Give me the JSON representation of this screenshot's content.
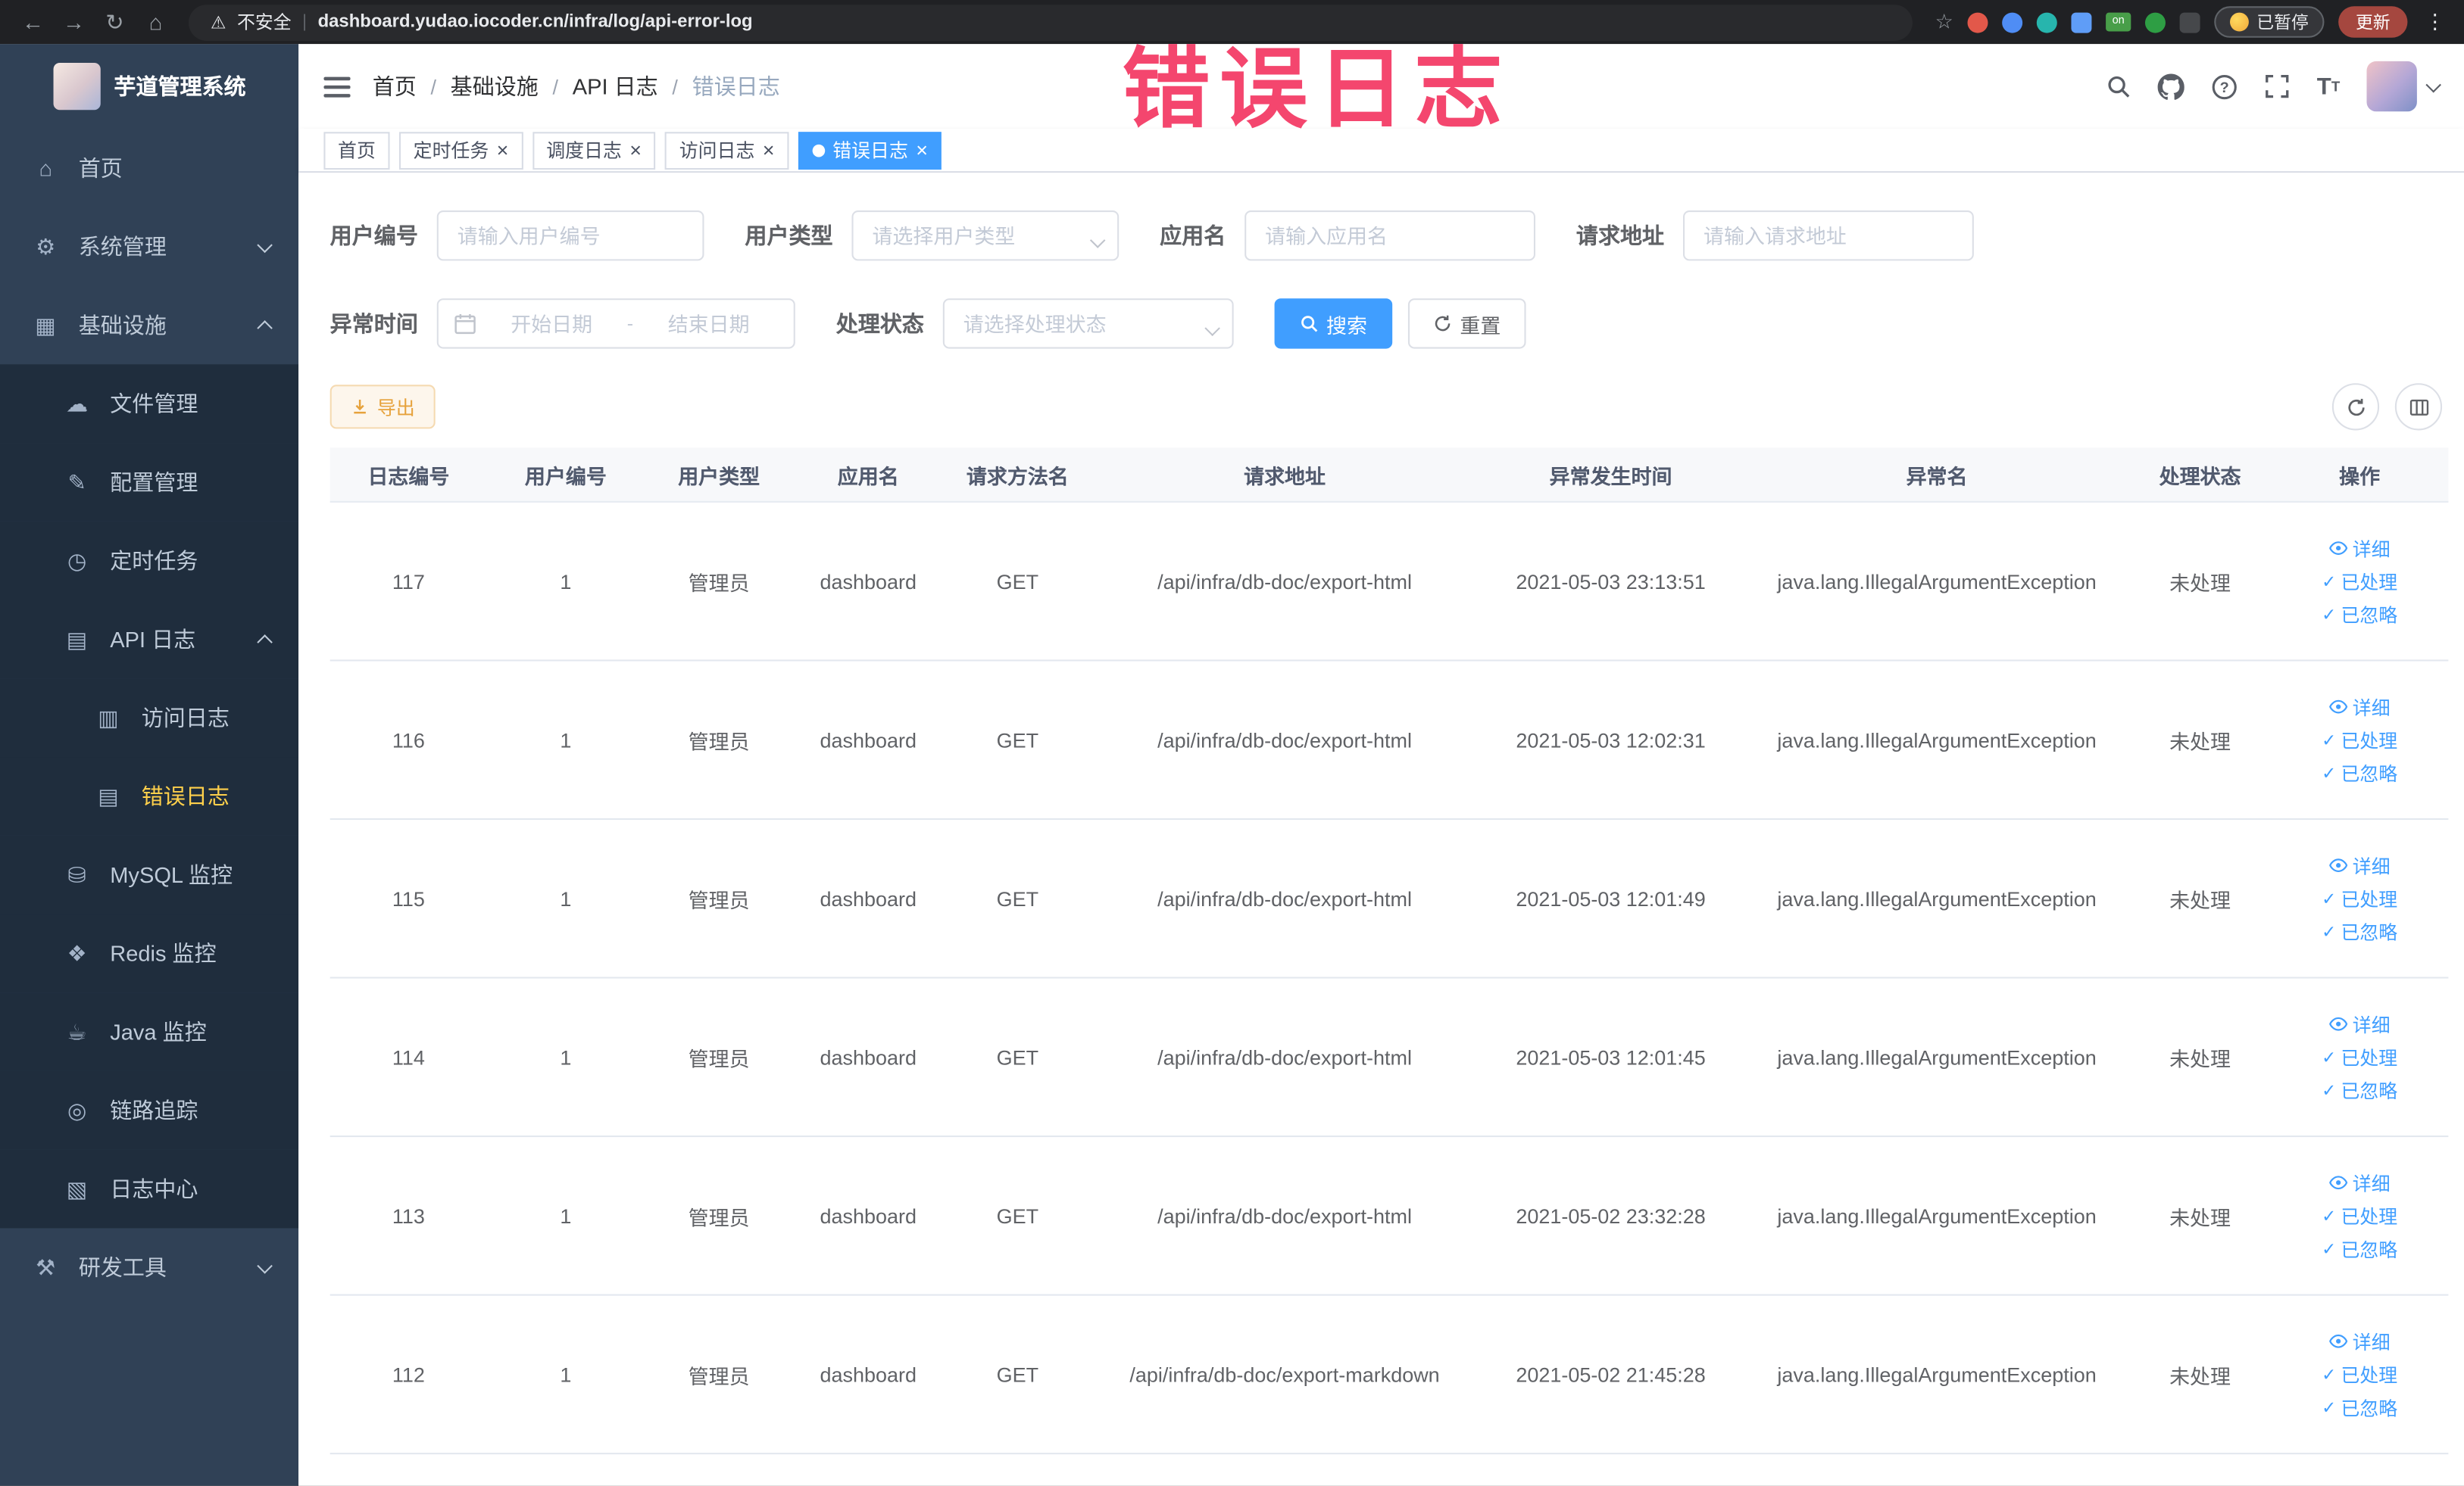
{
  "colors": {
    "primary": "#409eff",
    "annotation": "#f4466e",
    "warning": "#e6a23c",
    "sidebar_active": "#ffd04b"
  },
  "annotation": {
    "text": "错误日志"
  },
  "browser": {
    "security_label": "不安全",
    "url": "dashboard.yudao.iocoder.cn/infra/log/api-error-log",
    "paused_badge": "已暂停",
    "update_button": "更新"
  },
  "sidebar": {
    "logo_title": "芋道管理系统",
    "items": [
      {
        "key": "home",
        "label": "首页",
        "icon": "home-icon",
        "level": 0
      },
      {
        "key": "system",
        "label": "系统管理",
        "icon": "gear-icon",
        "level": 0,
        "expand": "down"
      },
      {
        "key": "infra",
        "label": "基础设施",
        "icon": "infrastructure-icon",
        "level": 0,
        "expand": "up"
      },
      {
        "key": "file",
        "label": "文件管理",
        "icon": "cloud-icon",
        "level": 1
      },
      {
        "key": "config",
        "label": "配置管理",
        "icon": "edit-icon",
        "level": 1
      },
      {
        "key": "job",
        "label": "定时任务",
        "icon": "timer-icon",
        "level": 1
      },
      {
        "key": "api-log",
        "label": "API 日志",
        "icon": "document-icon",
        "level": 1,
        "expand": "up"
      },
      {
        "key": "access-log",
        "label": "访问日志",
        "icon": "access-log-icon",
        "level": 2
      },
      {
        "key": "error-log",
        "label": "错误日志",
        "icon": "error-log-icon",
        "level": 2,
        "active": true
      },
      {
        "key": "mysql",
        "label": "MySQL 监控",
        "icon": "database-icon",
        "level": 1
      },
      {
        "key": "redis",
        "label": "Redis 监控",
        "icon": "redis-icon",
        "level": 1
      },
      {
        "key": "java",
        "label": "Java 监控",
        "icon": "java-icon",
        "level": 1
      },
      {
        "key": "trace",
        "label": "链路追踪",
        "icon": "trace-icon",
        "level": 1
      },
      {
        "key": "log-center",
        "label": "日志中心",
        "icon": "log-center-icon",
        "level": 1
      },
      {
        "key": "dev-tools",
        "label": "研发工具",
        "icon": "tools-icon",
        "level": 0,
        "expand": "down"
      }
    ]
  },
  "header": {
    "breadcrumb": [
      "首页",
      "基础设施",
      "API 日志",
      "错误日志"
    ]
  },
  "tabs": [
    {
      "label": "首页",
      "closable": false,
      "active": false
    },
    {
      "label": "定时任务",
      "closable": true,
      "active": false
    },
    {
      "label": "调度日志",
      "closable": true,
      "active": false
    },
    {
      "label": "访问日志",
      "closable": true,
      "active": false
    },
    {
      "label": "错误日志",
      "closable": true,
      "active": true
    }
  ],
  "filters": {
    "fields": [
      {
        "label": "用户编号",
        "placeholder": "请输入用户编号"
      },
      {
        "label": "用户类型",
        "placeholder": "请选择用户类型"
      },
      {
        "label": "应用名",
        "placeholder": "请输入应用名"
      },
      {
        "label": "请求地址",
        "placeholder": "请输入请求地址"
      },
      {
        "label": "异常时间",
        "start_placeholder": "开始日期",
        "end_placeholder": "结束日期",
        "separator": "-"
      },
      {
        "label": "处理状态",
        "placeholder": "请选择处理状态"
      }
    ],
    "search_button": "搜索",
    "reset_button": "重置"
  },
  "toolbar": {
    "export_label": "导出"
  },
  "table": {
    "columns": [
      "日志编号",
      "用户编号",
      "用户类型",
      "应用名",
      "请求方法名",
      "请求地址",
      "异常发生时间",
      "异常名",
      "处理状态",
      "操作"
    ],
    "row_actions": [
      "详细",
      "已处理",
      "已忽略"
    ],
    "rows": [
      {
        "id": "117",
        "user_id": "1",
        "user_type": "管理员",
        "app": "dashboard",
        "method": "GET",
        "url": "/api/infra/db-doc/export-html",
        "time": "2021-05-03 23:13:51",
        "exception": "java.lang.IllegalArgumentException",
        "status": "未处理"
      },
      {
        "id": "116",
        "user_id": "1",
        "user_type": "管理员",
        "app": "dashboard",
        "method": "GET",
        "url": "/api/infra/db-doc/export-html",
        "time": "2021-05-03 12:02:31",
        "exception": "java.lang.IllegalArgumentException",
        "status": "未处理"
      },
      {
        "id": "115",
        "user_id": "1",
        "user_type": "管理员",
        "app": "dashboard",
        "method": "GET",
        "url": "/api/infra/db-doc/export-html",
        "time": "2021-05-03 12:01:49",
        "exception": "java.lang.IllegalArgumentException",
        "status": "未处理"
      },
      {
        "id": "114",
        "user_id": "1",
        "user_type": "管理员",
        "app": "dashboard",
        "method": "GET",
        "url": "/api/infra/db-doc/export-html",
        "time": "2021-05-03 12:01:45",
        "exception": "java.lang.IllegalArgumentException",
        "status": "未处理"
      },
      {
        "id": "113",
        "user_id": "1",
        "user_type": "管理员",
        "app": "dashboard",
        "method": "GET",
        "url": "/api/infra/db-doc/export-html",
        "time": "2021-05-02 23:32:28",
        "exception": "java.lang.IllegalArgumentException",
        "status": "未处理"
      },
      {
        "id": "112",
        "user_id": "1",
        "user_type": "管理员",
        "app": "dashboard",
        "method": "GET",
        "url": "/api/infra/db-doc/export-markdown",
        "time": "2021-05-02 21:45:28",
        "exception": "java.lang.IllegalArgumentException",
        "status": "未处理"
      }
    ]
  }
}
